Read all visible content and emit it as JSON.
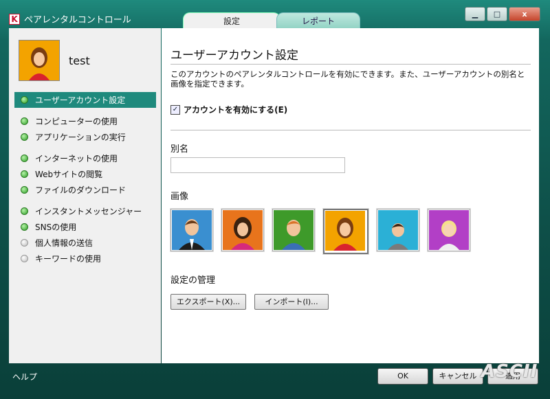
{
  "window": {
    "title": "ペアレンタルコントロール",
    "tabs": [
      {
        "label": "設定"
      },
      {
        "label": "レポート"
      }
    ],
    "controls": {
      "minimize": "▁",
      "maximize": "□",
      "close": "x"
    }
  },
  "sidebar": {
    "user_name": "test",
    "items": [
      {
        "label": "ユーザーアカウント設定",
        "enabled": true,
        "selected": true
      },
      {
        "label": "コンピューターの使用",
        "enabled": true
      },
      {
        "label": "アプリケーションの実行",
        "enabled": true
      },
      {
        "label": "インターネットの使用",
        "enabled": true
      },
      {
        "label": "Webサイトの閲覧",
        "enabled": true
      },
      {
        "label": "ファイルのダウンロード",
        "enabled": true
      },
      {
        "label": "インスタントメッセンジャー",
        "enabled": true
      },
      {
        "label": "SNSの使用",
        "enabled": true
      },
      {
        "label": "個人情報の送信",
        "enabled": false
      },
      {
        "label": "キーワードの使用",
        "enabled": false
      }
    ]
  },
  "main": {
    "heading": "ユーザーアカウント設定",
    "description": "このアカウントのペアレンタルコントロールを有効にできます。また、ユーザーアカウントの別名と画像を指定できます。",
    "enable_checkbox": {
      "label": "アカウントを有効にする(E)",
      "checked": true
    },
    "alias_label": "別名",
    "alias_value": "",
    "image_label": "画像",
    "images": [
      {
        "icon": "man-suit-avatar-icon",
        "bg": "#3a8fd0"
      },
      {
        "icon": "woman-pink-avatar-icon",
        "bg": "#e8741c"
      },
      {
        "icon": "boy-green-avatar-icon",
        "bg": "#3e9a2a"
      },
      {
        "icon": "girl-orange-avatar-icon",
        "bg": "#f3a300",
        "selected": true
      },
      {
        "icon": "child-cyan-avatar-icon",
        "bg": "#2bb0d6"
      },
      {
        "icon": "blonde-purple-avatar-icon",
        "bg": "#b23fc6"
      }
    ],
    "manage_label": "設定の管理",
    "export_button": "エクスポート(X)...",
    "import_button": "インポート(I)..."
  },
  "footer": {
    "help": "ヘルプ",
    "ok": "OK",
    "cancel": "キャンセル",
    "apply": "適用",
    "watermark": "ASCII"
  }
}
